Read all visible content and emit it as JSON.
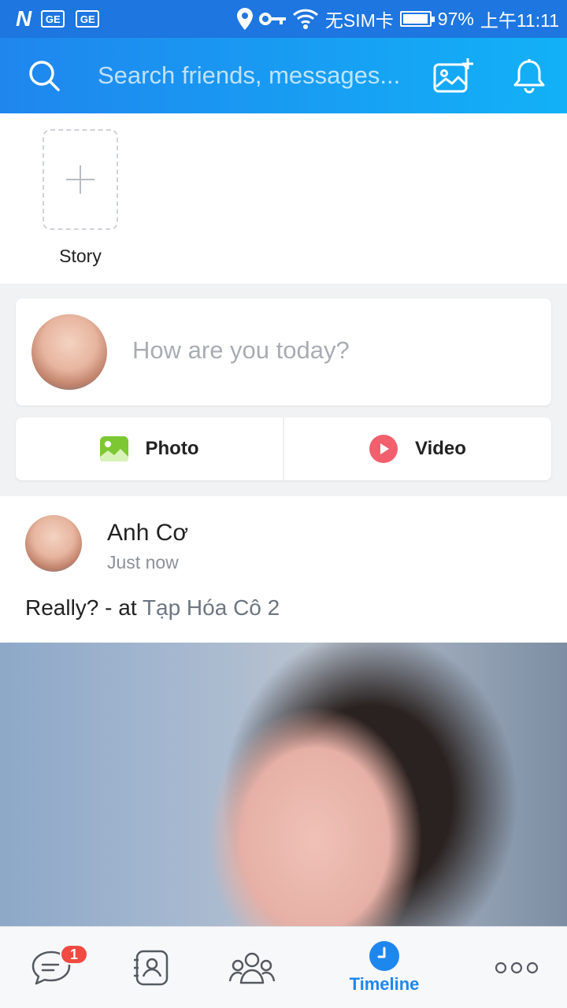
{
  "status_bar": {
    "left_icons": [
      "n-icon",
      "ge-icon",
      "ge-icon"
    ],
    "ge_label": "GE",
    "n_label": "N",
    "carrier": "无SIM卡",
    "battery_level": 0.97,
    "battery": "97%",
    "time": "上午11:11"
  },
  "header": {
    "search_placeholder": "Search friends, messages...",
    "accent_color": "#1f86ee"
  },
  "stories": {
    "add_label": "Story"
  },
  "composer": {
    "prompt": "How are you today?",
    "photo_label": "Photo",
    "video_label": "Video"
  },
  "post": {
    "author": "Anh Cơ",
    "time": "Just now",
    "text": "Really? - at ",
    "location": "Tạp Hóa Cô 2"
  },
  "bottom_nav": {
    "messages_badge": "1",
    "active_label": "Timeline",
    "active_color": "#1d87ee",
    "badge_color": "#f04a42"
  }
}
